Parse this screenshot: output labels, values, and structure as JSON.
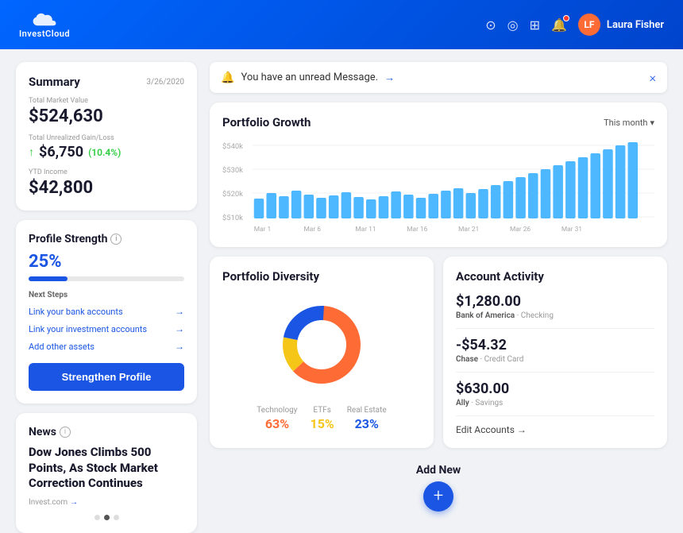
{
  "header": {
    "logo_text": "InvestCloud",
    "user_name": "Laura Fisher",
    "user_initials": "LF"
  },
  "notification": {
    "message": "You have an unread Message.",
    "link_text": "→",
    "close": "×"
  },
  "summary": {
    "title": "Summary",
    "date": "3/26/2020",
    "total_market_value_label": "Total Market Value",
    "total_market_value": "$524,630",
    "unrealized_label": "Total Unrealized Gain/Loss",
    "unrealized_value": "$6,750",
    "unrealized_pct": "(10.4%)",
    "ytd_label": "YTD Income",
    "ytd_value": "$42,800"
  },
  "profile_strength": {
    "title": "Profile Strength",
    "percentage": "25%",
    "fill_width": "25%",
    "next_steps_label": "Next Steps",
    "steps": [
      {
        "text": "Link your bank accounts",
        "arrow": "→"
      },
      {
        "text": "Link your investment accounts",
        "arrow": "→"
      },
      {
        "text": "Add other assets",
        "arrow": "→"
      }
    ],
    "button_label": "Strengthen Profile"
  },
  "news": {
    "title": "News",
    "headline": "Dow Jones Climbs 500 Points, As Stock Market Correction Continues",
    "source": "Invest.com",
    "source_arrow": "→"
  },
  "portfolio_growth": {
    "title": "Portfolio Growth",
    "period": "This month",
    "y_labels": [
      "$540k",
      "$530k",
      "$520k",
      "$510k"
    ],
    "x_labels": [
      "Mar 1",
      "Mar 6",
      "Mar 11",
      "Mar 16",
      "Mar 21",
      "Mar 26",
      "Mar 31"
    ],
    "bars": [
      14,
      16,
      15,
      17,
      16,
      14,
      15,
      16,
      15,
      14,
      15,
      17,
      16,
      15,
      16,
      17,
      18,
      16,
      17,
      18,
      19,
      20,
      21,
      22,
      24,
      26,
      28,
      30,
      32,
      34,
      38
    ]
  },
  "portfolio_diversity": {
    "title": "Portfolio Diversity",
    "segments": [
      {
        "label": "Technology",
        "pct": "63%",
        "value": 63,
        "color": "#ff6b35",
        "class": "tech"
      },
      {
        "label": "ETFs",
        "pct": "15%",
        "value": 15,
        "color": "#f5c518",
        "class": "etf"
      },
      {
        "label": "Real Estate",
        "pct": "23%",
        "value": 23,
        "color": "#1a55e3",
        "class": "real"
      }
    ]
  },
  "account_activity": {
    "title": "Account Activity",
    "accounts": [
      {
        "amount": "$1,280.00",
        "bank": "Bank of America",
        "type": "Checking"
      },
      {
        "amount": "-$54.32",
        "bank": "Chase",
        "type": "Credit Card"
      },
      {
        "amount": "$630.00",
        "bank": "Ally",
        "type": "Savings"
      }
    ],
    "edit_label": "Edit Accounts →"
  },
  "add_new": {
    "label": "Add New",
    "icon": "+"
  }
}
